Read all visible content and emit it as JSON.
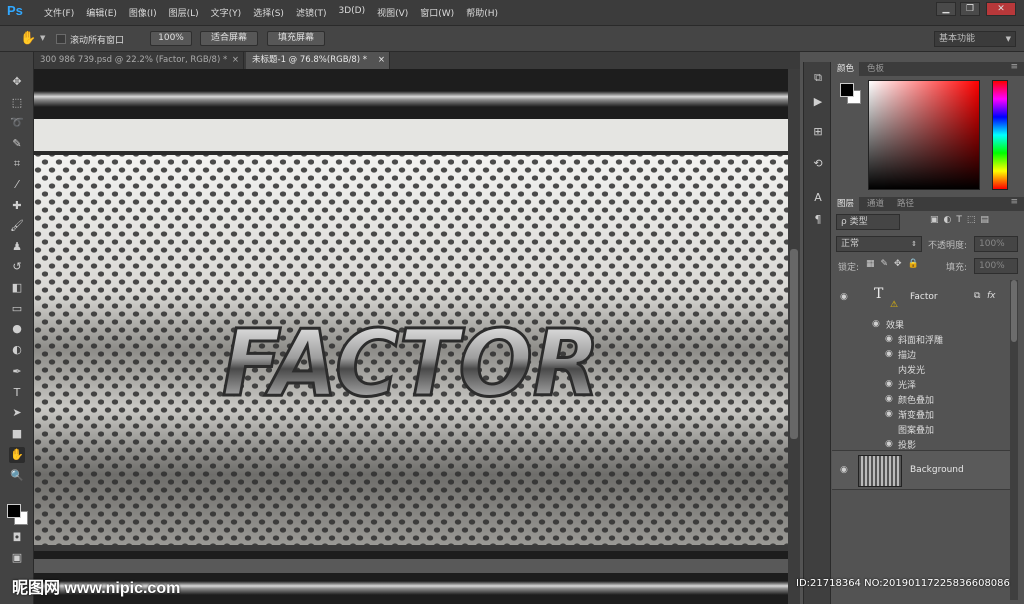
{
  "app": {
    "logo": "Ps"
  },
  "menu": [
    "文件(F)",
    "编辑(E)",
    "图像(I)",
    "图层(L)",
    "文字(Y)",
    "选择(S)",
    "滤镜(T)",
    "3D(D)",
    "视图(V)",
    "窗口(W)",
    "帮助(H)"
  ],
  "window_controls": {
    "minimize": "▁",
    "restore": "❐",
    "close": "✕"
  },
  "options": {
    "scroll_all": "滚动所有窗口",
    "zoom_100": "100%",
    "fit_screen": "适合屏幕",
    "fill_screen": "填充屏幕",
    "workspace": "基本功能"
  },
  "tabs": [
    {
      "label": "300 986 739.psd @ 22.2% (Factor, RGB/8) *",
      "close": "×"
    },
    {
      "label": "未标题-1 @ 76.8%(RGB/8) *",
      "close": "×"
    }
  ],
  "canvas_text": "FACTOR",
  "color_panel": {
    "tabs": [
      "颜色",
      "色板"
    ]
  },
  "layers_panel": {
    "tabs": [
      "图层",
      "通道",
      "路径"
    ],
    "filter_kind": "ρ 类型",
    "blend_mode": "正常",
    "opacity_label": "不透明度:",
    "opacity_value": "100%",
    "lock_label": "锁定:",
    "fill_label": "填充:",
    "fill_value": "100%",
    "layers": [
      {
        "name": "Factor",
        "type": "text",
        "fx": "fx"
      },
      {
        "name": "Background",
        "type": "image"
      }
    ],
    "effects_label": "效果",
    "effects": [
      {
        "name": "斜面和浮雕",
        "visible": true
      },
      {
        "name": "描边",
        "visible": true
      },
      {
        "name": "内发光",
        "visible": false
      },
      {
        "name": "光泽",
        "visible": true
      },
      {
        "name": "颜色叠加",
        "visible": true
      },
      {
        "name": "渐变叠加",
        "visible": true
      },
      {
        "name": "图案叠加",
        "visible": false
      },
      {
        "name": "投影",
        "visible": true
      }
    ]
  },
  "watermark": {
    "left": "昵图网 www.nipic.com",
    "right": "ID:21718364 NO:20190117225836608086"
  },
  "colors": {
    "ps_blue": "#31a8ff",
    "panel": "#535353",
    "dark": "#3c3c3c"
  }
}
